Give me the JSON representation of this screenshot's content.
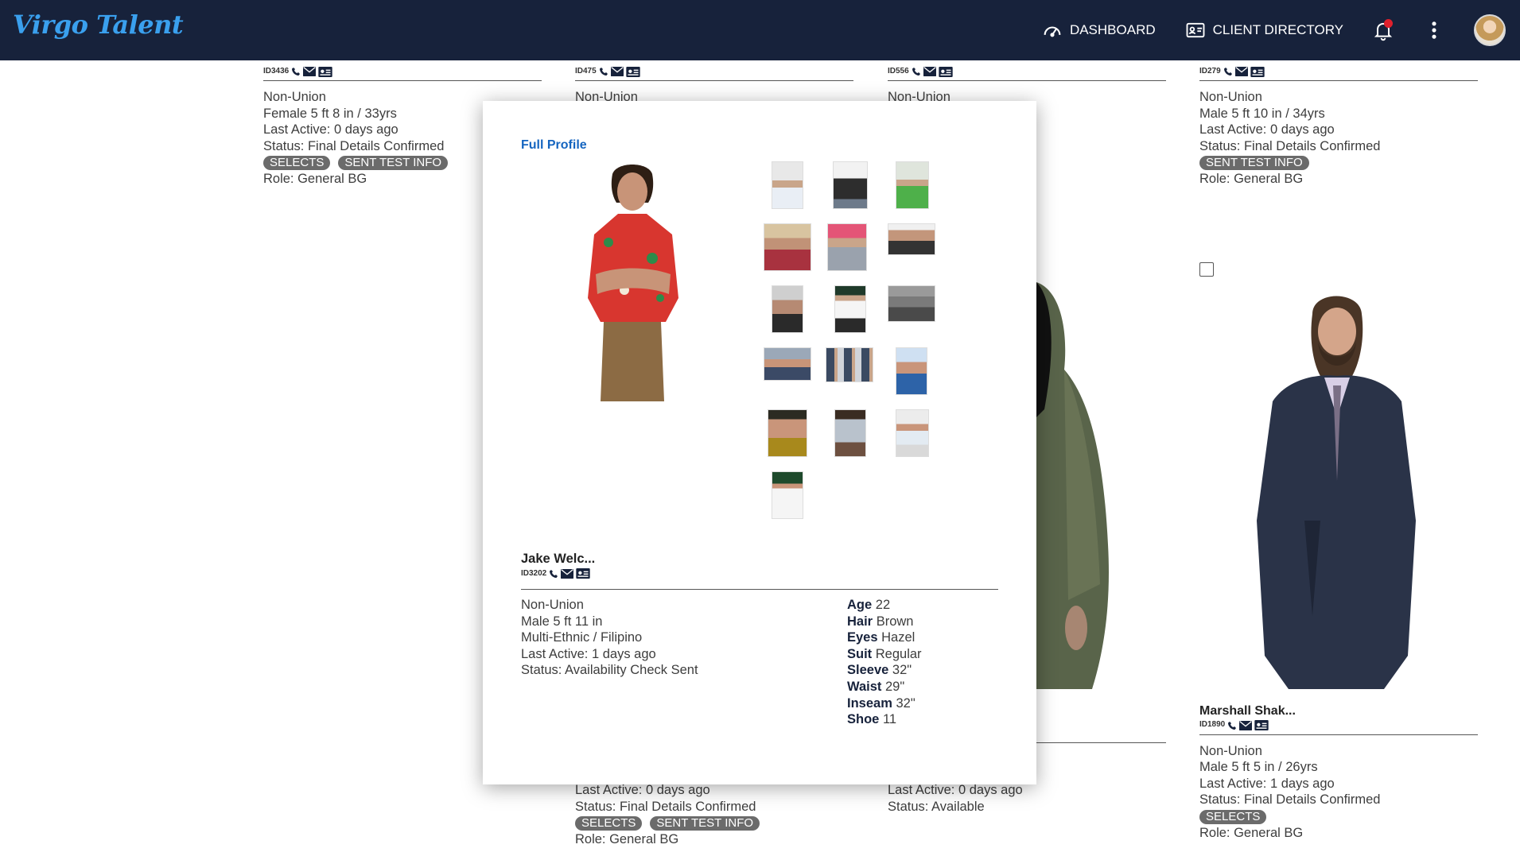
{
  "app": {
    "brand": "Virgo Talent"
  },
  "nav": {
    "dashboard": "DASHBOARD",
    "client_directory": "CLIENT DIRECTORY"
  },
  "cards": [
    {
      "id": "ID3436",
      "union": "Non-Union",
      "line2": "Female 5 ft 8 in / 33yrs",
      "last_active": "Last Active: 0 days ago",
      "status": "Status: Final Details Confirmed",
      "tags": [
        "SELECTS",
        "SENT TEST INFO"
      ],
      "role": "Role: General BG"
    },
    {
      "id": "ID475",
      "union": "Non-Union",
      "last_active": "Last Active: 0 days ago",
      "status": "Status: Final Details Confirmed",
      "tags": [
        "SELECTS",
        "SENT TEST INFO"
      ],
      "role": "Role: General BG"
    },
    {
      "id": "ID556",
      "union": "Non-Union",
      "last_active": "Last Active: 0 days ago",
      "status": "Status: Available"
    },
    {
      "id": "ID279",
      "union": "Non-Union",
      "line2": "Male 5 ft 10 in / 34yrs",
      "last_active": "Last Active: 0 days ago",
      "status": "Status: Final Details Confirmed",
      "tags": [
        "SENT TEST INFO"
      ],
      "role": "Role: General BG"
    },
    {
      "name": "Marshall Shak...",
      "id": "ID1890",
      "union": "Non-Union",
      "line2": "Male 5 ft 5 in / 26yrs",
      "last_active": "Last Active: 1 days ago",
      "status": "Status: Final Details Confirmed",
      "tags": [
        "SELECTS"
      ],
      "role": "Role: General BG"
    }
  ],
  "modal": {
    "full_profile": "Full Profile",
    "name": "Jake Welc...",
    "id": "ID3202",
    "union": "Non-Union",
    "body": "Male 5 ft 11 in",
    "ethnicity": "Multi-Ethnic / Filipino",
    "last_active": "Last Active: 1 days ago",
    "status": "Status: Availability Check Sent",
    "stats": {
      "age_label": "Age",
      "age": "22",
      "hair_label": "Hair",
      "hair": "Brown",
      "eyes_label": "Eyes",
      "eyes": "Hazel",
      "suit_label": "Suit",
      "suit": "Regular",
      "sleeve_label": "Sleeve",
      "sleeve": "32\"",
      "waist_label": "Waist",
      "waist": "29\"",
      "inseam_label": "Inseam",
      "inseam": "32\"",
      "shoe_label": "Shoe",
      "shoe": "11"
    }
  },
  "colors": {
    "topbar": "#17223b",
    "brand": "#3aa0ee",
    "link": "#1565c0",
    "tag": "#6b6b6b",
    "notification": "#e0202c"
  }
}
